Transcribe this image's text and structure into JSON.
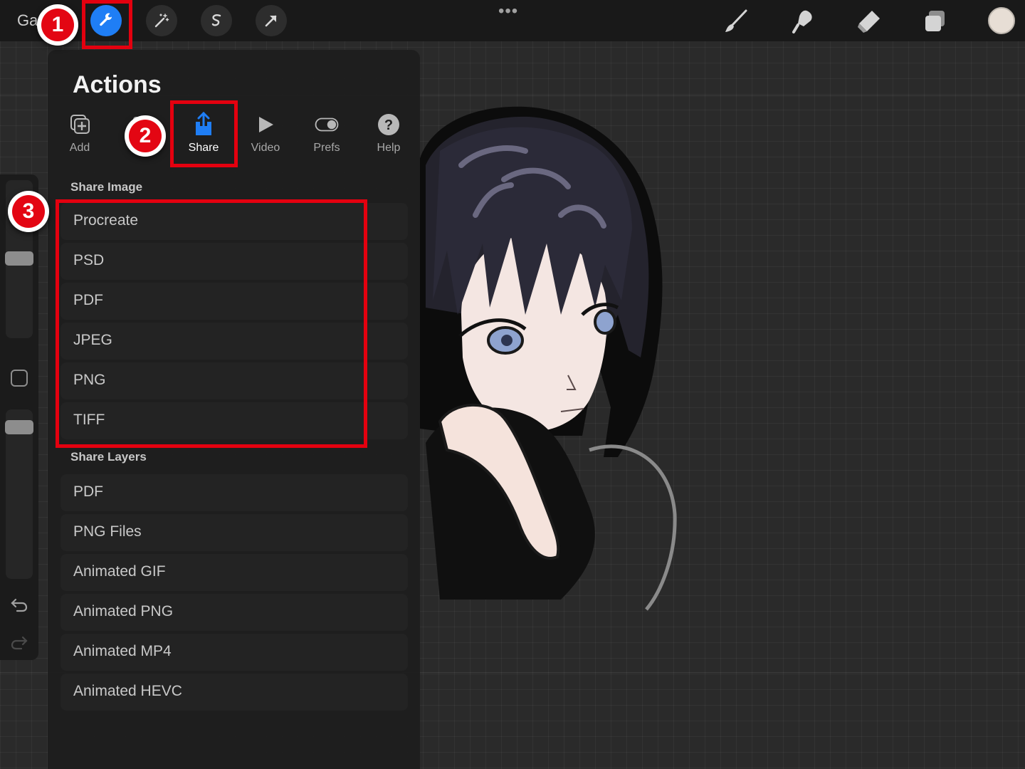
{
  "topbar": {
    "gallery_label": "Ga",
    "more_dots": "•••",
    "left_tools": [
      {
        "name": "actions-wrench-icon",
        "active": true
      },
      {
        "name": "adjustments-magic-wand-icon"
      },
      {
        "name": "selection-icon"
      },
      {
        "name": "transform-arrow-icon"
      }
    ],
    "right_tools": [
      "brush-icon",
      "smudge-icon",
      "eraser-icon",
      "layers-icon"
    ],
    "current_color": "#e7ded5"
  },
  "actions_panel": {
    "title": "Actions",
    "tabs": [
      {
        "label": "Add",
        "icon": "add-icon"
      },
      {
        "label": "C",
        "icon": "canvas-icon"
      },
      {
        "label": "Share",
        "icon": "share-icon",
        "active": true
      },
      {
        "label": "Video",
        "icon": "video-play-icon"
      },
      {
        "label": "Prefs",
        "icon": "toggle-icon"
      },
      {
        "label": "Help",
        "icon": "help-icon"
      }
    ],
    "share_image": {
      "label": "Share Image",
      "items": [
        "Procreate",
        "PSD",
        "PDF",
        "JPEG",
        "PNG",
        "TIFF"
      ]
    },
    "share_layers": {
      "label": "Share Layers",
      "items": [
        "PDF",
        "PNG Files",
        "Animated GIF",
        "Animated PNG",
        "Animated MP4",
        "Animated HEVC"
      ]
    }
  },
  "annotations": {
    "badges": [
      "1",
      "2",
      "3"
    ],
    "color": "#e30613"
  },
  "colors": {
    "accent": "#1f7ef5",
    "panel": "#1e1e1e",
    "highlight": "#e4000f"
  }
}
